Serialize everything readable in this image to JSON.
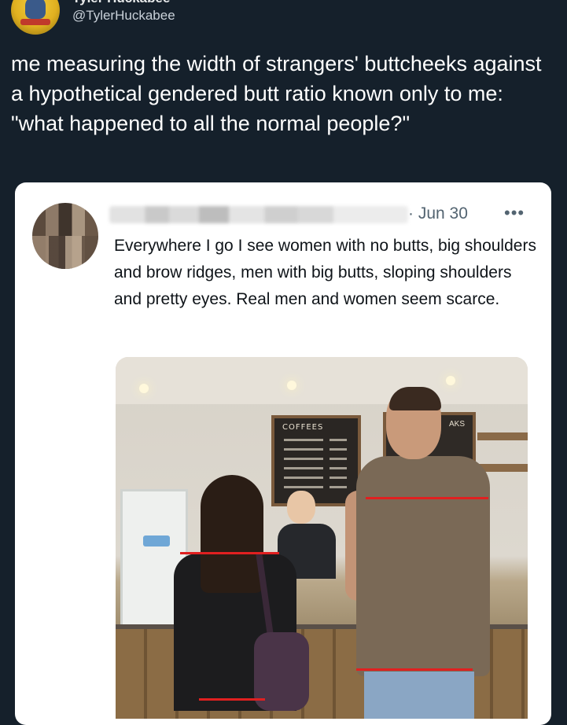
{
  "author": {
    "display_name": "Tyler Huckabee",
    "handle": "@TylerHuckabee"
  },
  "tweet": {
    "text": "me measuring the width of strangers' buttcheeks against a hypothetical gendered butt ratio known only to me: \"what happened to all the normal people?\""
  },
  "quoted_tweet": {
    "date": "· Jun 30",
    "more": "•••",
    "text": "Everywhere I go I see women with no butts, big shoulders and brow ridges, men with big butts, sloping shoulders and pretty eyes. Real men and women seem scarce.",
    "photo": {
      "menu_board_title": "COFFEES",
      "board2_title": "AKS"
    }
  },
  "colors": {
    "background": "#15202b",
    "annotation_lines": "#e02020"
  }
}
